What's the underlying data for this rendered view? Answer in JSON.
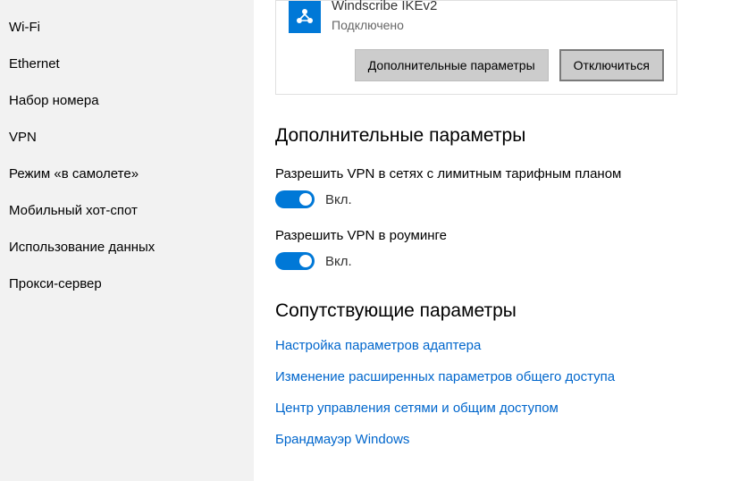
{
  "sidebar": {
    "items": [
      {
        "label": "Wi-Fi"
      },
      {
        "label": "Ethernet"
      },
      {
        "label": "Набор номера"
      },
      {
        "label": "VPN"
      },
      {
        "label": "Режим «в самолете»"
      },
      {
        "label": "Мобильный хот-спот"
      },
      {
        "label": "Использование данных"
      },
      {
        "label": "Прокси-сервер"
      }
    ]
  },
  "connection": {
    "name": "Windscribe IKEv2",
    "status": "Подключено",
    "btn_more": "Дополнительные параметры",
    "btn_disconnect": "Отключиться"
  },
  "advanced": {
    "heading": "Дополнительные параметры",
    "metered_label": "Разрешить VPN в сетях с лимитным тарифным планом",
    "metered_state": "Вкл.",
    "roaming_label": "Разрешить VPN в роуминге",
    "roaming_state": "Вкл."
  },
  "related": {
    "heading": "Сопутствующие параметры",
    "links": [
      "Настройка параметров адаптера",
      "Изменение расширенных параметров общего доступа",
      "Центр управления сетями и общим доступом",
      "Брандмауэр Windows"
    ]
  }
}
